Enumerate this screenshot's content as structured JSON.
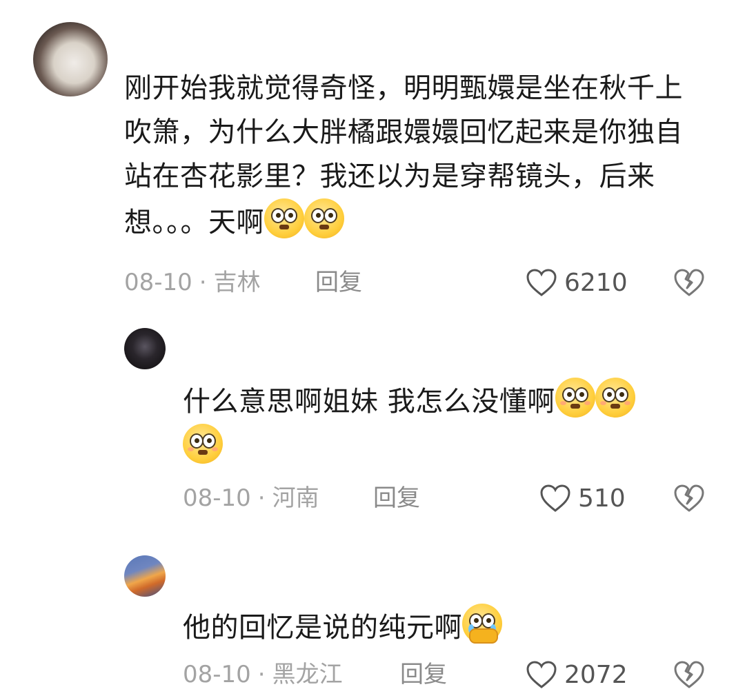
{
  "comments": [
    {
      "text": "刚开始我就觉得奇怪，明明甄嬛是坐在秋千上吹箫，为什么大胖橘跟嬛嬛回忆起来是你独自站在杏花影里？我还以为是穿帮镜头，后来想。。。天啊",
      "emoji": "flushed-face-emoji",
      "date": "08-10",
      "location": "吉林",
      "reply_label": "回复",
      "likes": "6210"
    },
    {
      "text": "什么意思啊姐妹 我怎么没懂啊",
      "emoji": "pleading-face-emoji",
      "date": "08-10",
      "location": "河南",
      "reply_label": "回复",
      "likes": "510"
    },
    {
      "text": "他的回忆是说的纯元啊",
      "emoji": "crying-face-holding-back-tears-emoji",
      "date": "08-10",
      "location": "黑龙江",
      "reply_label": "回复",
      "likes": "2072"
    }
  ],
  "separator": "·"
}
